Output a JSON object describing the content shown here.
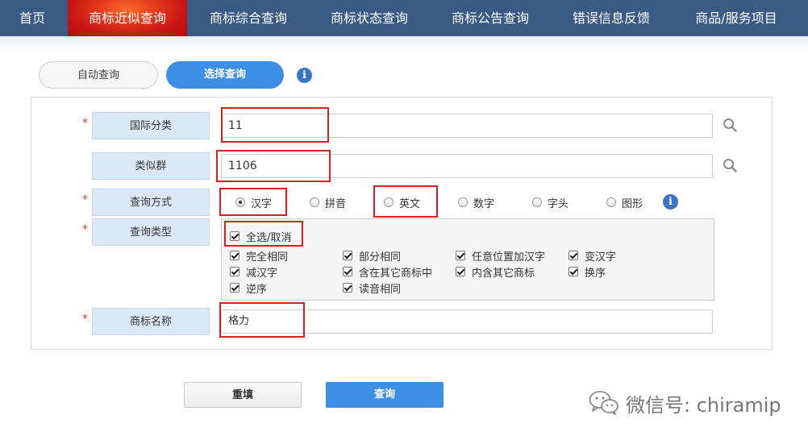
{
  "nav": {
    "items": [
      "首页",
      "商标近似查询",
      "商标综合查询",
      "商标状态查询",
      "商标公告查询",
      "错误信息反馈",
      "商品/服务项目"
    ],
    "active_index": 1
  },
  "modes": {
    "auto": "自动查询",
    "select": "选择查询"
  },
  "info_glyph": "i",
  "required_mark": "*",
  "form": {
    "intl_class": {
      "label": "国际分类",
      "value": "11"
    },
    "similar_group": {
      "label": "类似群",
      "value": "1106"
    },
    "query_method": {
      "label": "查询方式",
      "options": [
        "汉字",
        "拼音",
        "英文",
        "数字",
        "字头",
        "图形"
      ],
      "selected": "汉字"
    },
    "query_type": {
      "label": "查询类型",
      "select_all": "全选/取消",
      "options": [
        "完全相同",
        "部分相同",
        "任意位置加汉字",
        "变汉字",
        "减汉字",
        "含在其它商标中",
        "内含其它商标",
        "换序",
        "逆序",
        "读音相同"
      ]
    },
    "trademark_name": {
      "label": "商标名称",
      "value": "格力"
    }
  },
  "buttons": {
    "reset": "重填",
    "query": "查询"
  },
  "watermark": "微信号: chiramip",
  "colors": {
    "nav_bg": "#3a5a86",
    "nav_active": "#d11f1f",
    "accent_blue": "#3d8fe6",
    "label_bg": "#dbe9f7",
    "highlight_red": "#d92020"
  },
  "icons": [
    "search-icon",
    "info-icon",
    "wechat-logo-icon"
  ]
}
